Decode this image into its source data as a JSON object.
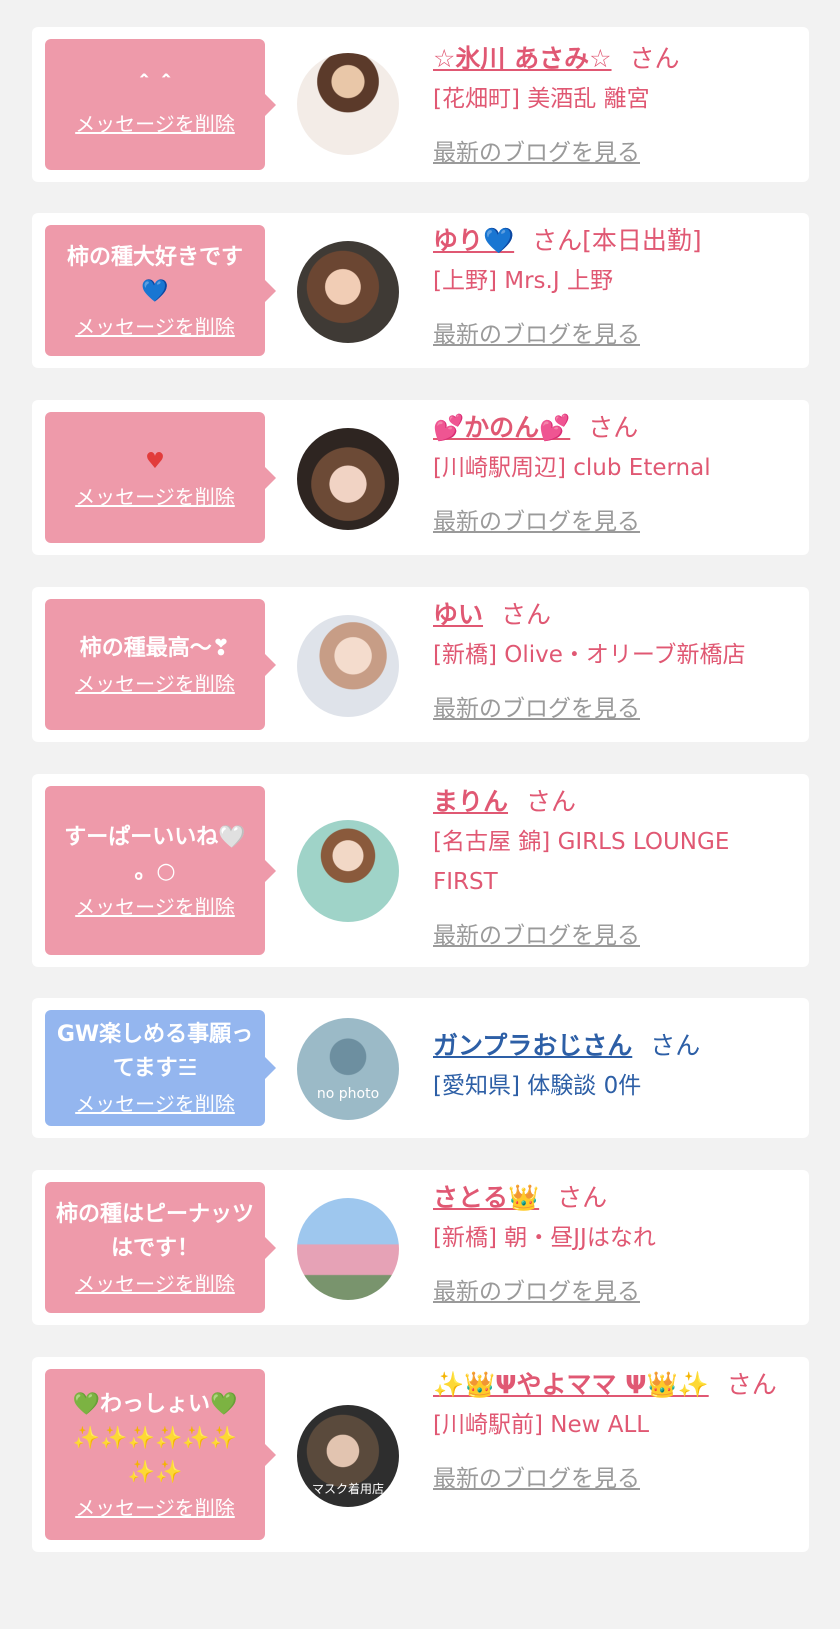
{
  "delete_label": "メッセージを削除",
  "blog_label": "最新のブログを見る",
  "honorific": "さん",
  "items": [
    {
      "message": "＾＾",
      "name": "☆氷川 あさみ☆",
      "honorific_extra": "",
      "shop": "[花畑町] 美酒乱 離宮",
      "show_blog": true
    },
    {
      "message": "柿の種大好きです\n💙",
      "name": "ゆり💙",
      "honorific_extra": "[本日出勤]",
      "shop": "[上野] Mrs.J 上野",
      "show_blog": true
    },
    {
      "message": "♥",
      "name": "💕かのん💕",
      "honorific_extra": "",
      "shop": "[川崎駅周辺] club Eternal",
      "show_blog": true
    },
    {
      "message": "柿の種最高〜❣",
      "name": "ゆい",
      "honorific_extra": "",
      "shop": "[新橋] Olive・オリーブ新橋店",
      "show_blog": true
    },
    {
      "message": "すーぱーいいね🤍\n。○",
      "name": "まりん",
      "honorific_extra": "",
      "shop": "[名古屋 錦] GIRLS LOUNGE FIRST",
      "show_blog": true
    },
    {
      "message": "GW楽しめる事願ってます☱",
      "name": "ガンプラおじさん",
      "honorific_extra": "",
      "shop": "[愛知県] 体験談 0件",
      "show_blog": false,
      "avatar_text": "no photo"
    },
    {
      "message": "柿の種はピーナッツはです！",
      "name": "さとる👑",
      "honorific_extra": "",
      "shop": "[新橋] 朝・昼JJはなれ",
      "show_blog": true
    },
    {
      "message": "💚わっしょい💚\n✨✨✨✨✨✨\n✨✨",
      "name": "✨👑Ψやよママ Ψ👑✨",
      "honorific_extra": "",
      "shop": "[川崎駅前] New ALL",
      "show_blog": true,
      "avatar_text": "マスク着用店"
    }
  ],
  "colors": {
    "pink_bubble": "#ee9aaa",
    "blue_bubble": "#94b6ef",
    "accent": "#e05873",
    "accent_blue": "#2d5fa6"
  }
}
